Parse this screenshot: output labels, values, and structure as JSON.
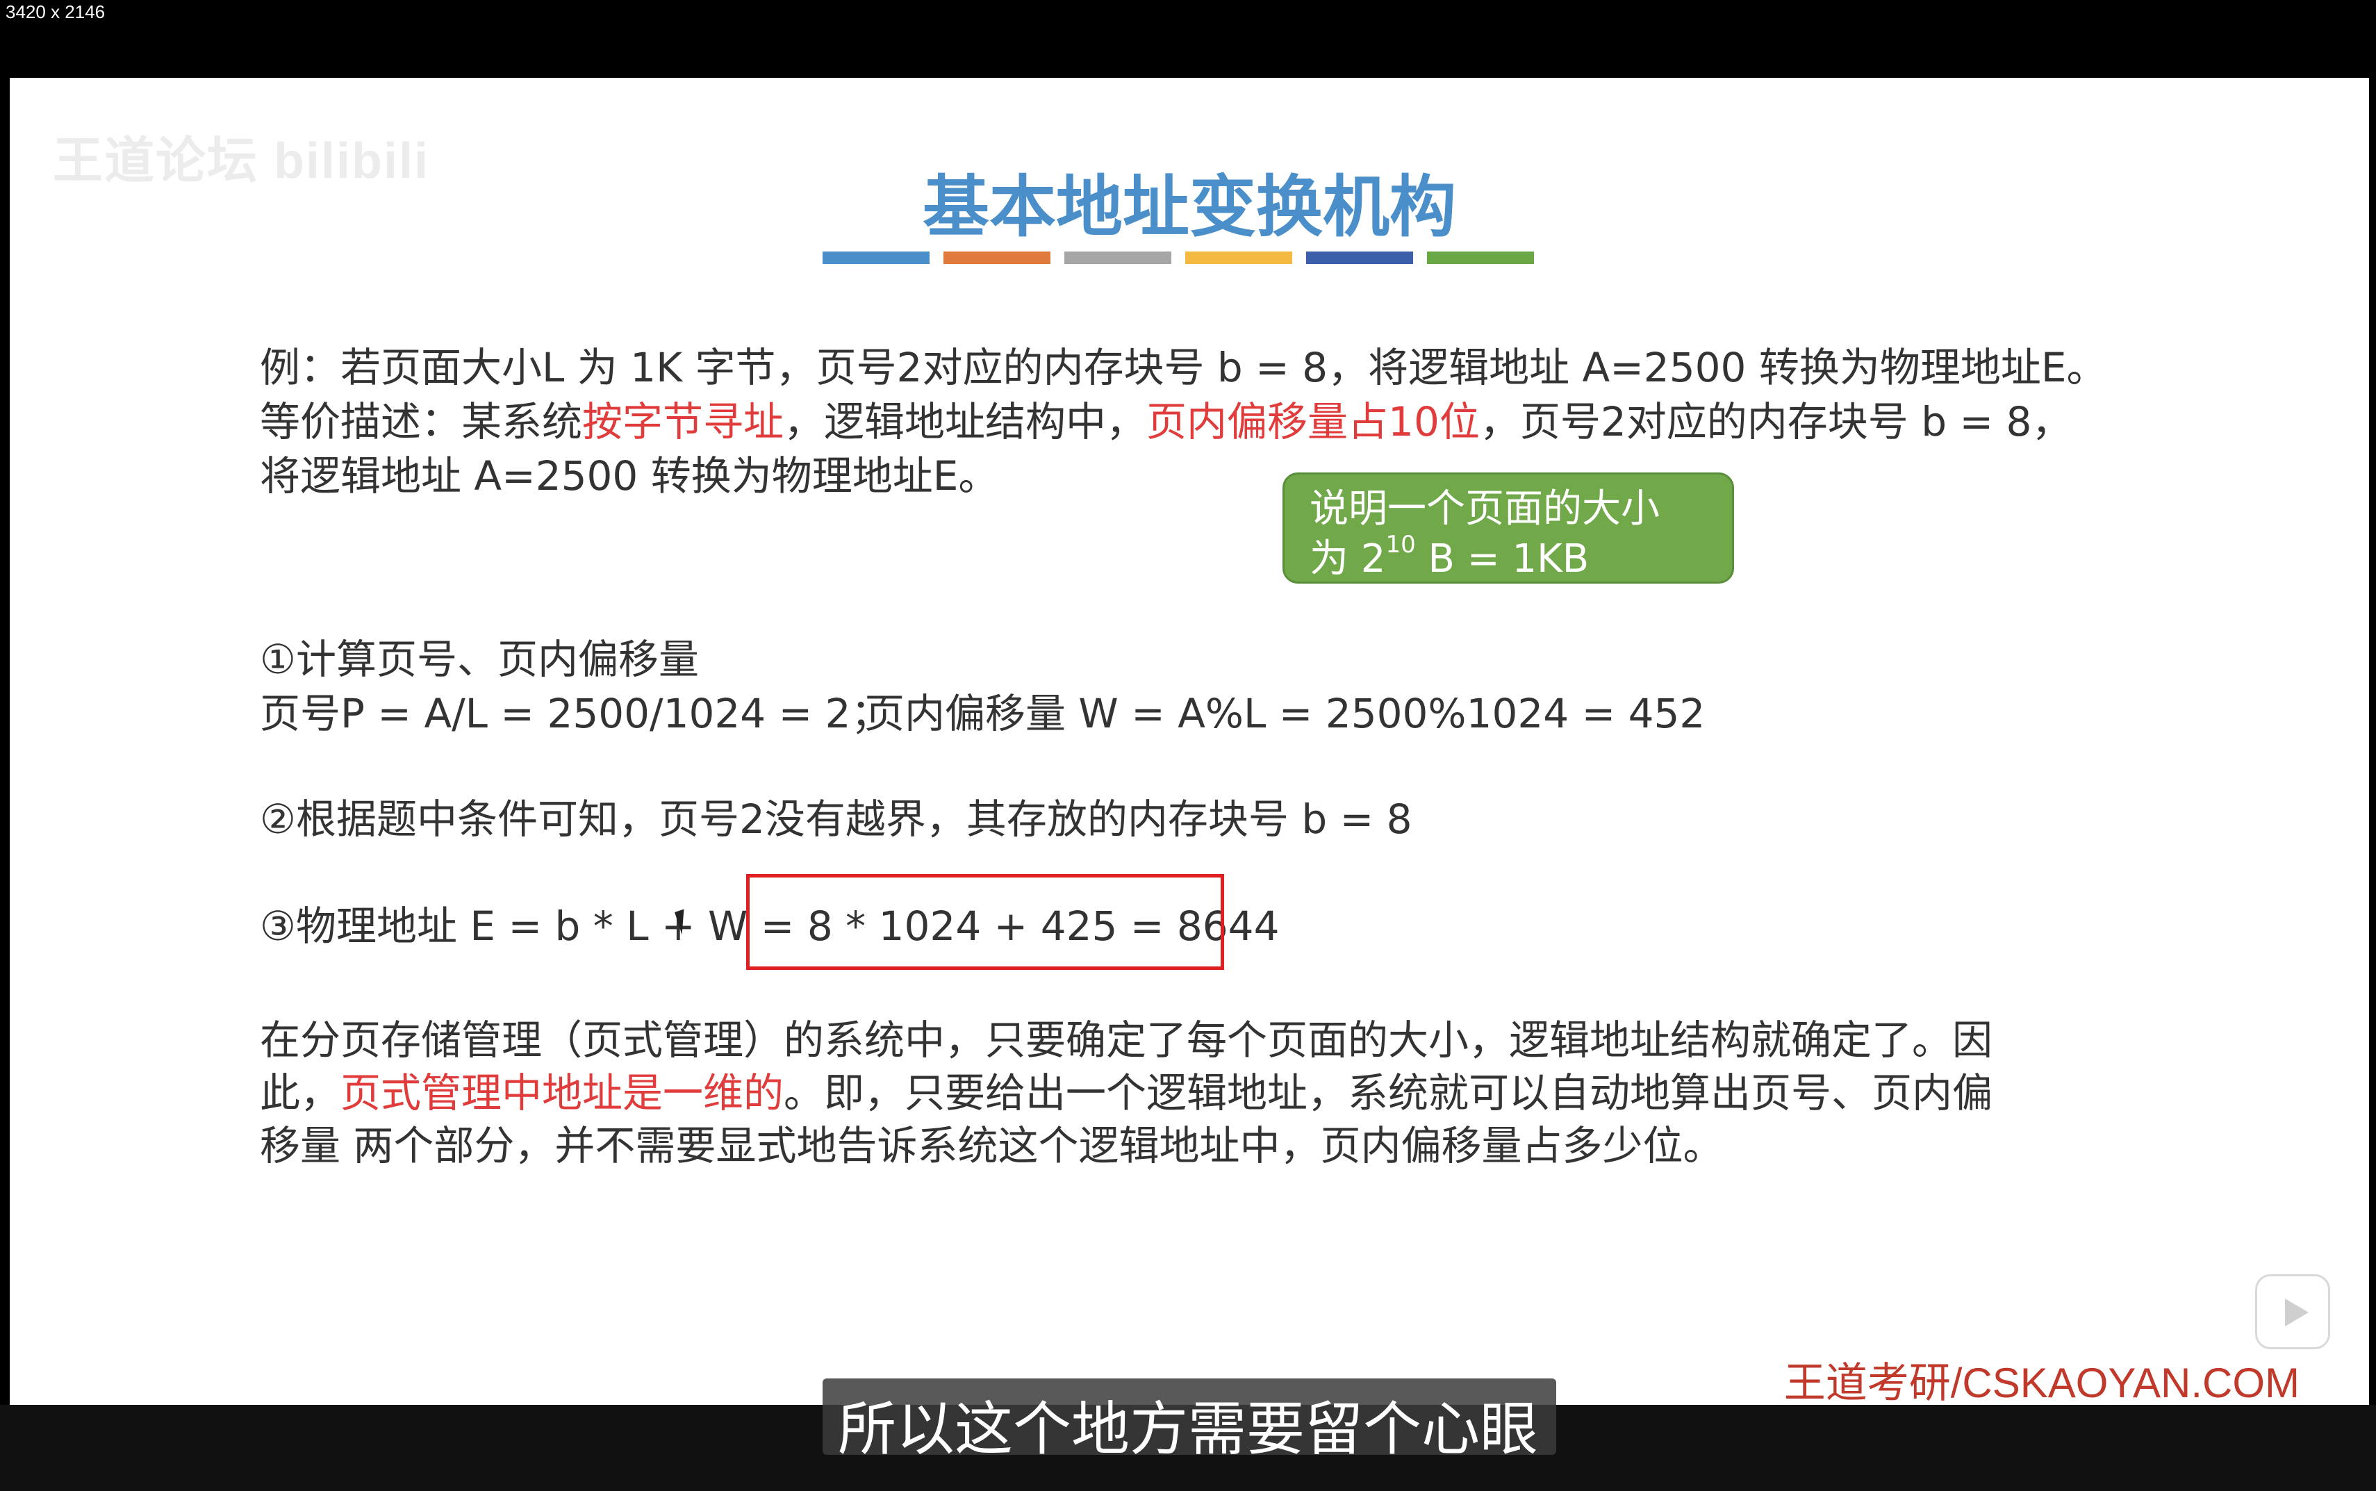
{
  "screen": {
    "dimension_label": "3420 x 2146"
  },
  "slide": {
    "watermark": "王道论坛 bilibili",
    "title": "基本地址变换机构",
    "title_bar_colors": [
      "#4a8fc9",
      "#e07a3c",
      "#a6a6a6",
      "#f4b940",
      "#3b5fa8",
      "#6aa845"
    ],
    "example": {
      "l1a": "例：若页面大小L 为 1K 字节，页号2对应的内存块号 b = 8，将逻辑地址 A=2500 转换为物理地址E。",
      "l2a": "等价描述：某系统",
      "l2b": "按字节寻址",
      "l2c": "，逻辑地址结构中，",
      "l2d": "页内偏移量占10位",
      "l2e": "，页号2对应的内存块号 b = 8，",
      "l3a": "将逻辑地址 A=2500 转换为物理地址E。"
    },
    "callout": {
      "line1": "说明一个页面的大小",
      "line2_prefix": "为 2",
      "line2_sup": "10",
      "line2_suffix": " B = 1KB"
    },
    "steps": {
      "s1_title": "①计算页号、页内偏移量",
      "s1_page": "页号P = A/L = 2500/1024 = 2；",
      "s1_offset": "页内偏移量 W = A%L = 2500%1024 = 452",
      "s2": "②根据题中条件可知，页号2没有越界，其存放的内存块号 b = 8",
      "s3_prefix": "③物理地址 E = b * L + W = ",
      "s3_boxed": "8 * 1024 + 425 = 8644"
    },
    "summary": {
      "l1": "在分页存储管理（页式管理）的系统中，只要确定了每个页面的大小，逻辑地址结构就确定了。因",
      "l2a": "此，",
      "l2b": "页式管理中地址是一维的",
      "l2c": "。即，只要给出一个逻辑地址，系统就可以自动地算出页号、页内偏",
      "l3": "移量 两个部分，并不需要显式地告诉系统这个逻辑地址中，页内偏移量占多少位。"
    },
    "footer_brand": "王道考研/CSKAOYAN.COM"
  },
  "video": {
    "subtitle": "所以这个地方需要留个心眼"
  }
}
